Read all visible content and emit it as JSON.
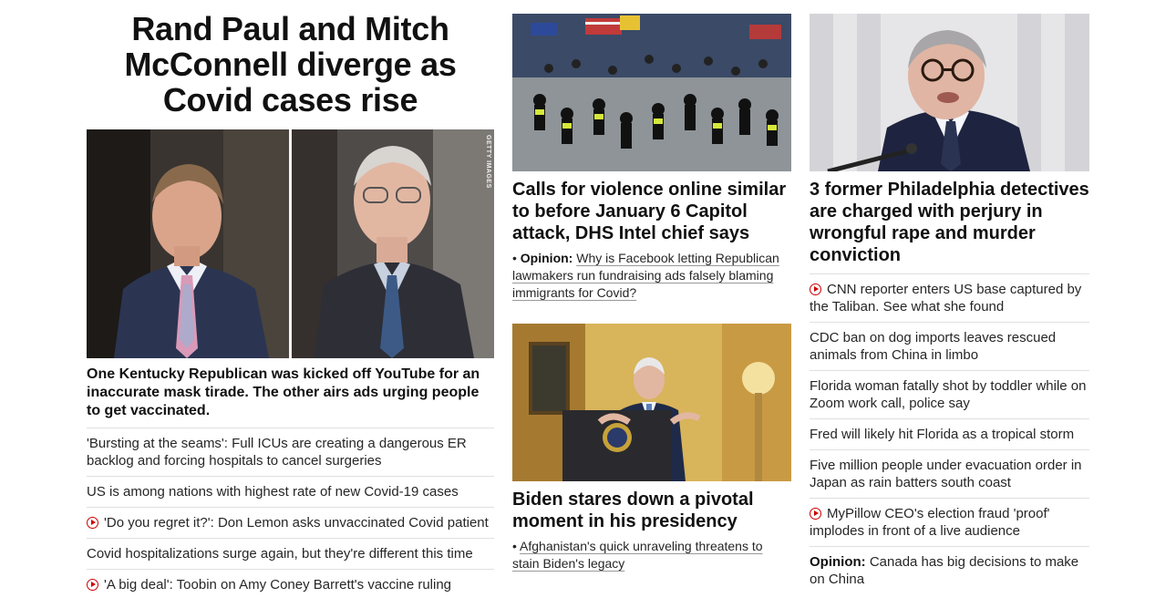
{
  "lead": {
    "headline": "Rand Paul and Mitch McConnell diverge as Covid cases rise",
    "photo_credit": "GETTY IMAGES",
    "subhead": "One Kentucky Republican was kicked off YouTube for an inaccurate mask tirade. The other airs ads urging people to get vaccinated.",
    "related": [
      {
        "text": "'Bursting at the seams': Full ICUs are creating a dangerous ER backlog and forcing hospitals to cancel surgeries",
        "video": false
      },
      {
        "text": "US is among nations with highest rate of new Covid-19 cases",
        "video": false
      },
      {
        "text": "'Do you regret it?': Don Lemon asks unvaccinated Covid patient",
        "video": true
      },
      {
        "text": "Covid hospitalizations surge again, but they're different this time",
        "video": false
      },
      {
        "text": "'A big deal': Toobin on Amy Coney Barrett's vaccine ruling",
        "video": true
      }
    ]
  },
  "middle": {
    "story1": {
      "title": "Calls for violence online similar to before January 6 Capitol attack, DHS Intel chief says",
      "sub_label": "Opinion:",
      "sub_text": "Why is Facebook letting Republican lawmakers run fundraising ads falsely blaming immigrants for Covid?"
    },
    "story2": {
      "title": "Biden stares down a pivotal moment in his presidency",
      "sub_text": "Afghanistan's quick unraveling threatens to stain Biden's legacy"
    }
  },
  "right": {
    "title": "3 former Philadelphia detectives are charged with perjury in wrongful rape and murder conviction",
    "items": [
      {
        "label": "",
        "text": "CNN reporter enters US base captured by the Taliban. See what she found",
        "video": true
      },
      {
        "label": "",
        "text": "CDC ban on dog imports leaves rescued animals from China in limbo",
        "video": false
      },
      {
        "label": "",
        "text": "Florida woman fatally shot by toddler while on Zoom work call, police say",
        "video": false
      },
      {
        "label": "",
        "text": "Fred will likely hit Florida as a tropical storm",
        "video": false
      },
      {
        "label": "",
        "text": "Five million people under evacuation order in Japan as rain batters south coast",
        "video": false
      },
      {
        "label": "",
        "text": "MyPillow CEO's election fraud 'proof' implodes in front of a live audience",
        "video": true
      },
      {
        "label": "Opinion:",
        "text": "Canada has big decisions to make on China",
        "video": false
      }
    ]
  },
  "colors": {
    "accent": "#cc0000",
    "divider": "#e0e0e0"
  },
  "icons": {
    "video": "play-icon"
  }
}
